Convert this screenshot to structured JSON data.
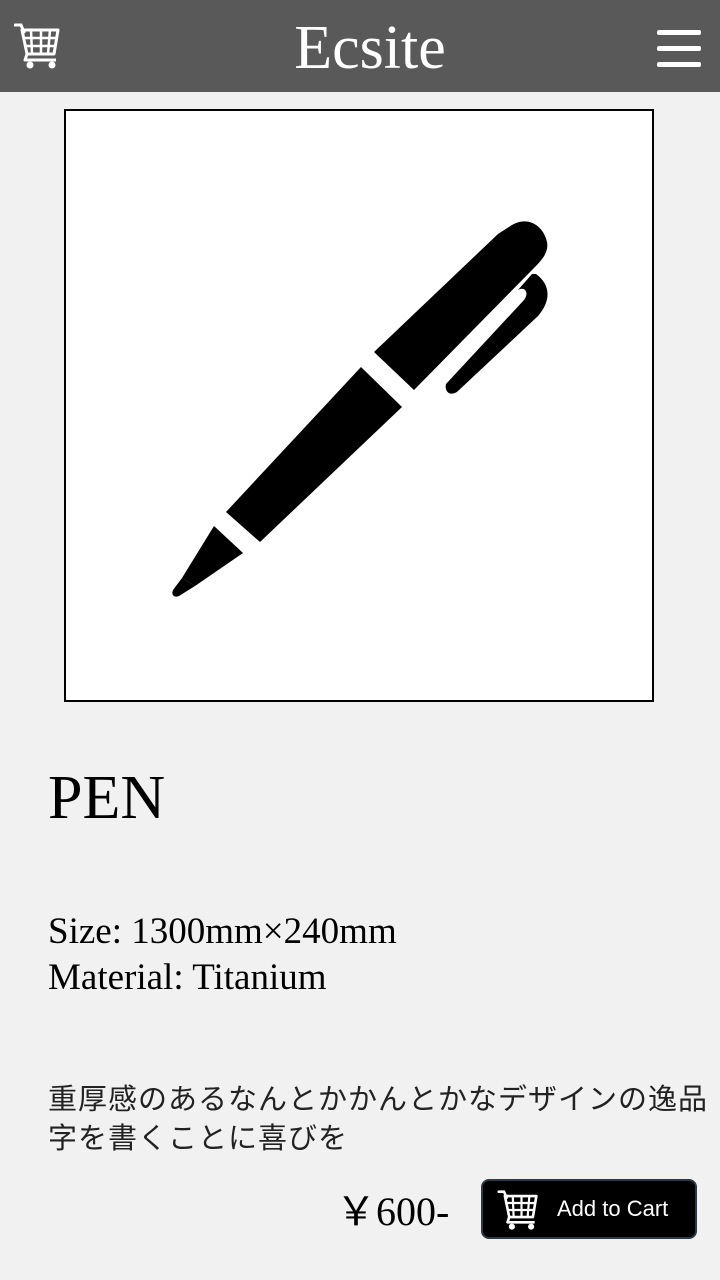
{
  "header": {
    "title": "Ecsite",
    "cart_icon": "shopping-cart-icon",
    "menu_icon": "hamburger-menu-icon",
    "background_color": "#595959"
  },
  "product": {
    "image_icon": "pen-icon",
    "name": "PEN",
    "size": "Size: 1300mm×240mm",
    "material": "Material: Titanium",
    "description": "重厚感のあるなんとかかんとかなデザインの逸品字を書くことに喜びを",
    "price": "￥600-"
  },
  "actions": {
    "add_to_cart_label": "Add to Cart",
    "add_to_cart_icon": "shopping-cart-icon"
  }
}
